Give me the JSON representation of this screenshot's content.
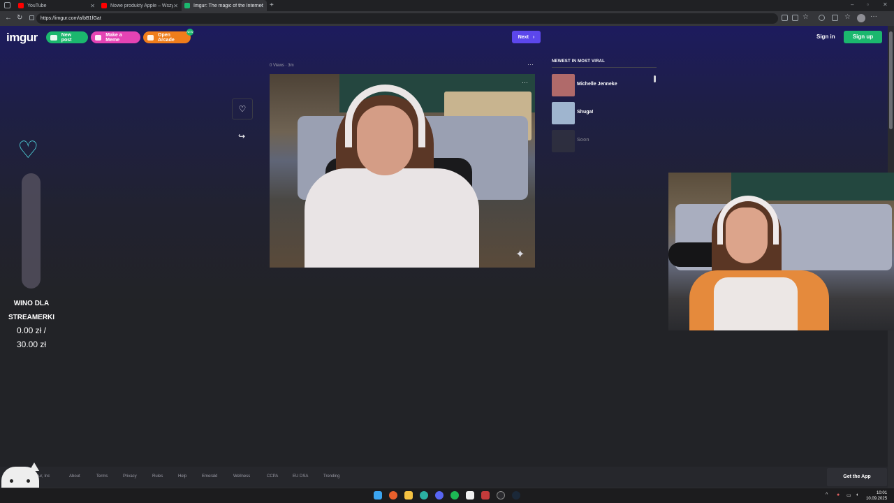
{
  "browser": {
    "tabs": [
      {
        "label": "YouTube",
        "favicon_color": "#ff0000"
      },
      {
        "label": "Nowe produkty Apple – Wszystk",
        "favicon_color": "#ff0000"
      },
      {
        "label": "Imgur: The magic of the Internet",
        "favicon_color": "#1bb76e",
        "active": true
      }
    ],
    "url": "https://imgur.com/a/bB1fGat"
  },
  "header": {
    "logo": "imgur",
    "new_post": "New post",
    "make_meme": "Make a Meme",
    "open_arcade": "Open Arcade",
    "arcade_badge": "NEW",
    "next": "Next",
    "sign_in": "Sign in",
    "sign_up": "Sign up"
  },
  "post": {
    "meta": "0 Views · 3m",
    "more": "···"
  },
  "sidebar": {
    "title": "NEWEST IN MOST VIRAL",
    "items": [
      {
        "name": "Michelle Jenneke",
        "thumb_color": "#b06a6a"
      },
      {
        "name": "Shuga!",
        "thumb_color": "#9fb5cf"
      },
      {
        "name": "Soon",
        "thumb_color": "#3a3b40"
      }
    ]
  },
  "overlay": {
    "goal_title_line1": "WINO DLA",
    "goal_title_line2": "STREAMERKI",
    "goal_amount_line1": "0.00 zł /",
    "goal_amount_line2": "30.00 zł",
    "goal_progress": 0
  },
  "footer": {
    "links": [
      "Imgur, Inc",
      "About",
      "Terms",
      "Privacy",
      "Rules",
      "Help",
      "Emerald",
      "Wellness",
      "CCPA",
      "EU DSA",
      "Trending"
    ],
    "get_app": "Get the App"
  },
  "taskbar": {
    "time": "10:01",
    "date": "10.09.2025"
  },
  "colors": {
    "accent_green": "#1bb76e",
    "accent_pink": "#e443b4",
    "accent_orange": "#f07d1b",
    "accent_purple": "#5c47ec"
  }
}
